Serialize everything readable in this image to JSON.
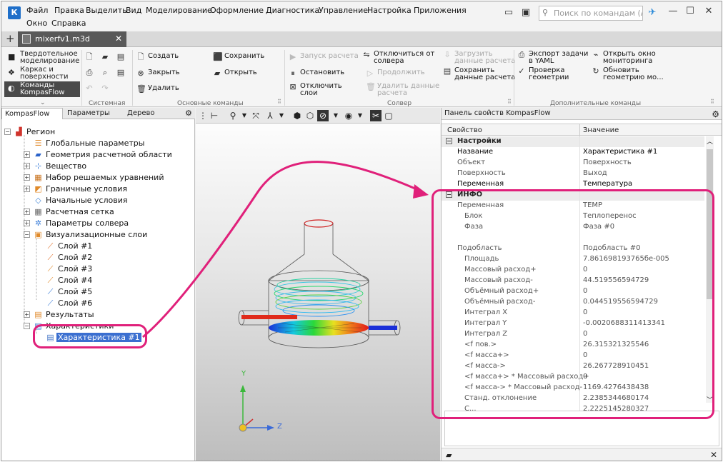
{
  "menu": {
    "items": [
      "Файл",
      "Правка",
      "Выделить",
      "Вид",
      "Моделирование",
      "Оформление",
      "Диагностика",
      "Управление",
      "Настройка",
      "Приложения"
    ],
    "items2": [
      "Окно",
      "Справка"
    ],
    "search_placeholder": "Поиск по командам (Al...",
    "minimize": "—",
    "maximize": "☐",
    "close": "✕"
  },
  "tabs": {
    "plus": "+",
    "doc_name": "mixerfv1.m3d",
    "close": "✕"
  },
  "ribbon": {
    "modes": [
      "Твердотельное моделирование",
      "Каркас и поверхности",
      "Команды KompasFlow"
    ],
    "group_system": "Системная",
    "group_main": "Основные команды",
    "group_solver": "Солвер",
    "group_extra": "Дополнительные команды",
    "create": "Создать",
    "save": "Сохранить",
    "close_cmd": "Закрыть",
    "open": "Открыть",
    "delete": "Удалить",
    "start_calc": "Запуск расчета",
    "disconnect_solver_1": "Отключиться от",
    "disconnect_solver_2": "солвера",
    "load_calc_1": "Загрузить",
    "load_calc_2": "данные расчета",
    "stop": "Остановить",
    "continue": "Продолжить",
    "save_calc_1": "Сохранить",
    "save_calc_2": "данные расчета",
    "disable_layers_1": "Отключить",
    "disable_layers_2": "слои",
    "delete_calc_1": "Удалить данные",
    "delete_calc_2": "расчета",
    "export_yaml_1": "Экспорт задачи",
    "export_yaml_2": "в YAML",
    "check_geom_1": "Проверка",
    "check_geom_2": "геометрии",
    "open_monitor_1": "Открыть окно",
    "open_monitor_2": "мониторинга",
    "update_geom_1": "Обновить",
    "update_geom_2": "геометрию мо..."
  },
  "left_panel": {
    "tabs": [
      "KompasFlow",
      "Параметры",
      "Дерево"
    ],
    "tree": [
      {
        "label": "Регион",
        "icon": "region-icon",
        "color": "#d0342c"
      },
      {
        "label": "Глобальные параметры",
        "icon": "global-params-icon",
        "color": "#e08a2a"
      },
      {
        "label": "Геометрия расчетной области",
        "icon": "geometry-icon",
        "color": "#2a62c9"
      },
      {
        "label": "Вещество",
        "icon": "substance-icon",
        "color": "#3a7dd8"
      },
      {
        "label": "Набор решаемых уравнений",
        "icon": "equations-icon",
        "color": "#c9731e"
      },
      {
        "label": "Граничные условия",
        "icon": "boundary-icon",
        "color": "#e08a2a"
      },
      {
        "label": "Начальные условия",
        "icon": "initial-icon",
        "color": "#4a8ad8"
      },
      {
        "label": "Расчетная сетка",
        "icon": "mesh-icon",
        "color": "#6a6a6a"
      },
      {
        "label": "Параметры солвера",
        "icon": "solver-params-icon",
        "color": "#3a7dd8"
      },
      {
        "label": "Визуализационные слои",
        "icon": "vis-layers-icon",
        "color": "#e08a2a"
      },
      {
        "label": "Слой #1",
        "icon": "layer-icon",
        "color": "#e0702a"
      },
      {
        "label": "Слой #2",
        "icon": "layer-icon",
        "color": "#e0702a"
      },
      {
        "label": "Слой #3",
        "icon": "layer-icon",
        "color": "#e08a2a"
      },
      {
        "label": "Слой #4",
        "icon": "layer-icon",
        "color": "#e08a2a"
      },
      {
        "label": "Слой #5",
        "icon": "layer-icon",
        "color": "#3a7dd8"
      },
      {
        "label": "Слой #6",
        "icon": "layer-icon",
        "color": "#3a7dd8"
      },
      {
        "label": "Результаты",
        "icon": "results-icon",
        "color": "#e08a2a"
      },
      {
        "label": "Характеристики",
        "icon": "characteristics-icon",
        "color": "#3a7dd8"
      },
      {
        "label": "Характеристика #1",
        "icon": "characteristic-icon",
        "color": "#4a7ac8"
      }
    ]
  },
  "viewport": {
    "axis_y": "Y",
    "axis_z": "Z"
  },
  "props": {
    "title": "Панель свойств KompasFlow",
    "col_property": "Свойство",
    "col_value": "Значение",
    "rows": [
      {
        "name": "Настройки",
        "value": "",
        "type": "section"
      },
      {
        "name": "Название",
        "value": "Характеристика #1",
        "type": "bold"
      },
      {
        "name": "Объект",
        "value": "Поверхность",
        "type": "dim"
      },
      {
        "name": "Поверхность",
        "value": "Выход",
        "type": "dim"
      },
      {
        "name": "Переменная",
        "value": "Температура",
        "type": "bold"
      },
      {
        "name": "ИНФО",
        "value": "",
        "type": "section"
      },
      {
        "name": "Переменная",
        "value": "TEMP",
        "type": "dim"
      },
      {
        "name": "Блок",
        "value": "Теплоперенос",
        "type": "dim2"
      },
      {
        "name": "Фаза",
        "value": "Фаза #0",
        "type": "dim2"
      },
      {
        "name": "",
        "value": "",
        "type": "dim"
      },
      {
        "name": "Подобласть",
        "value": "Подобласть #0",
        "type": "dim"
      },
      {
        "name": "Площадь",
        "value": "7.861698193765бе-005",
        "type": "dim2"
      },
      {
        "name": "Массовый расход+",
        "value": "0",
        "type": "dim2"
      },
      {
        "name": "Массовый расход-",
        "value": "44.519556594729",
        "type": "dim2"
      },
      {
        "name": "Объёмный расход+",
        "value": "0",
        "type": "dim2"
      },
      {
        "name": "Объёмный расход-",
        "value": "0.044519556594729",
        "type": "dim2"
      },
      {
        "name": "Интеграл X",
        "value": "0",
        "type": "dim2"
      },
      {
        "name": "Интеграл Y",
        "value": "-0.0020688311413341",
        "type": "dim2"
      },
      {
        "name": "Интеграл Z",
        "value": "0",
        "type": "dim2"
      },
      {
        "name": "<f пов.>",
        "value": "26.315321325546",
        "type": "dim2"
      },
      {
        "name": "<f масса+>",
        "value": "0",
        "type": "dim2"
      },
      {
        "name": "<f масса->",
        "value": "26.267728910451",
        "type": "dim2"
      },
      {
        "name": "<f масса+> * Массовый расход+",
        "value": "0",
        "type": "dim2"
      },
      {
        "name": "<f масса-> * Массовый расход-",
        "value": "1169.4276438438",
        "type": "dim2"
      },
      {
        "name": "Станд. отклонение",
        "value": "2.2385344680174",
        "type": "dim2"
      },
      {
        "name": "С...",
        "value": "2.2225145280327",
        "type": "dim2"
      }
    ]
  }
}
